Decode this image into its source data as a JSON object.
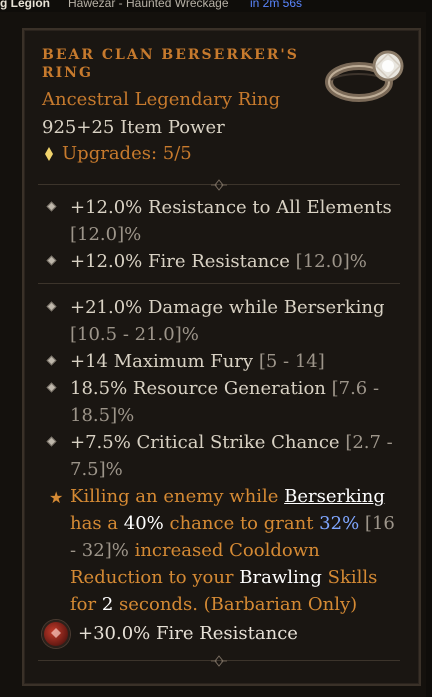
{
  "hud": {
    "left_text": "g Legion",
    "middle_text": "Hawezar - Haunted Wreckage",
    "right_text": "in 2m 56s"
  },
  "item": {
    "name_line1": "BEAR CLAN BERSERKER'S",
    "name_line2": "RING",
    "type": "Ancestral Legendary Ring",
    "power": "925+25 Item Power",
    "upgrades": "Upgrades: 5/5",
    "affixes_group1": [
      {
        "text": "+12.0% Resistance to All Elements",
        "range": "[12.0]%"
      },
      {
        "text": "+12.0% Fire Resistance",
        "range": "[12.0]%"
      }
    ],
    "affixes_group2": [
      {
        "text": "+21.0% Damage while Berserking",
        "range": "[10.5 - 21.0]%"
      },
      {
        "text": "+14 Maximum Fury",
        "range": "[5 - 14]"
      },
      {
        "text": "18.5% Resource Generation",
        "range": "[7.6 - 18.5]%"
      },
      {
        "text": "+7.5% Critical Strike Chance",
        "range": "[2.7 - 7.5]%"
      }
    ],
    "legendary_effect": {
      "p1": "Killing an enemy while",
      "berserking": "Berserking",
      "p2": "has a",
      "chance": "40%",
      "p3": "chance to grant",
      "value": "32%",
      "range": "[16 - 32]%",
      "p4": "increased Cooldown Reduction to your",
      "skill": "Brawling",
      "p5": "Skills for",
      "duration": "2",
      "p6": "seconds.",
      "class_note": "(Barbarian Only)"
    },
    "socket_text": "+30.0% Fire Resistance"
  },
  "icons": {
    "upgrade": "spark-icon",
    "bullet": "diamond-bullet-icon",
    "legendary": "star-icon",
    "socket": "ruby-gem-icon",
    "item": "ring-icon"
  },
  "colors": {
    "legendary_orange": "#c77a2d",
    "affix_gray": "#d9d2c4",
    "range_gray": "#9d958a",
    "highlight_blue": "#7fa6ff",
    "socket_red": "#c33b2b"
  }
}
